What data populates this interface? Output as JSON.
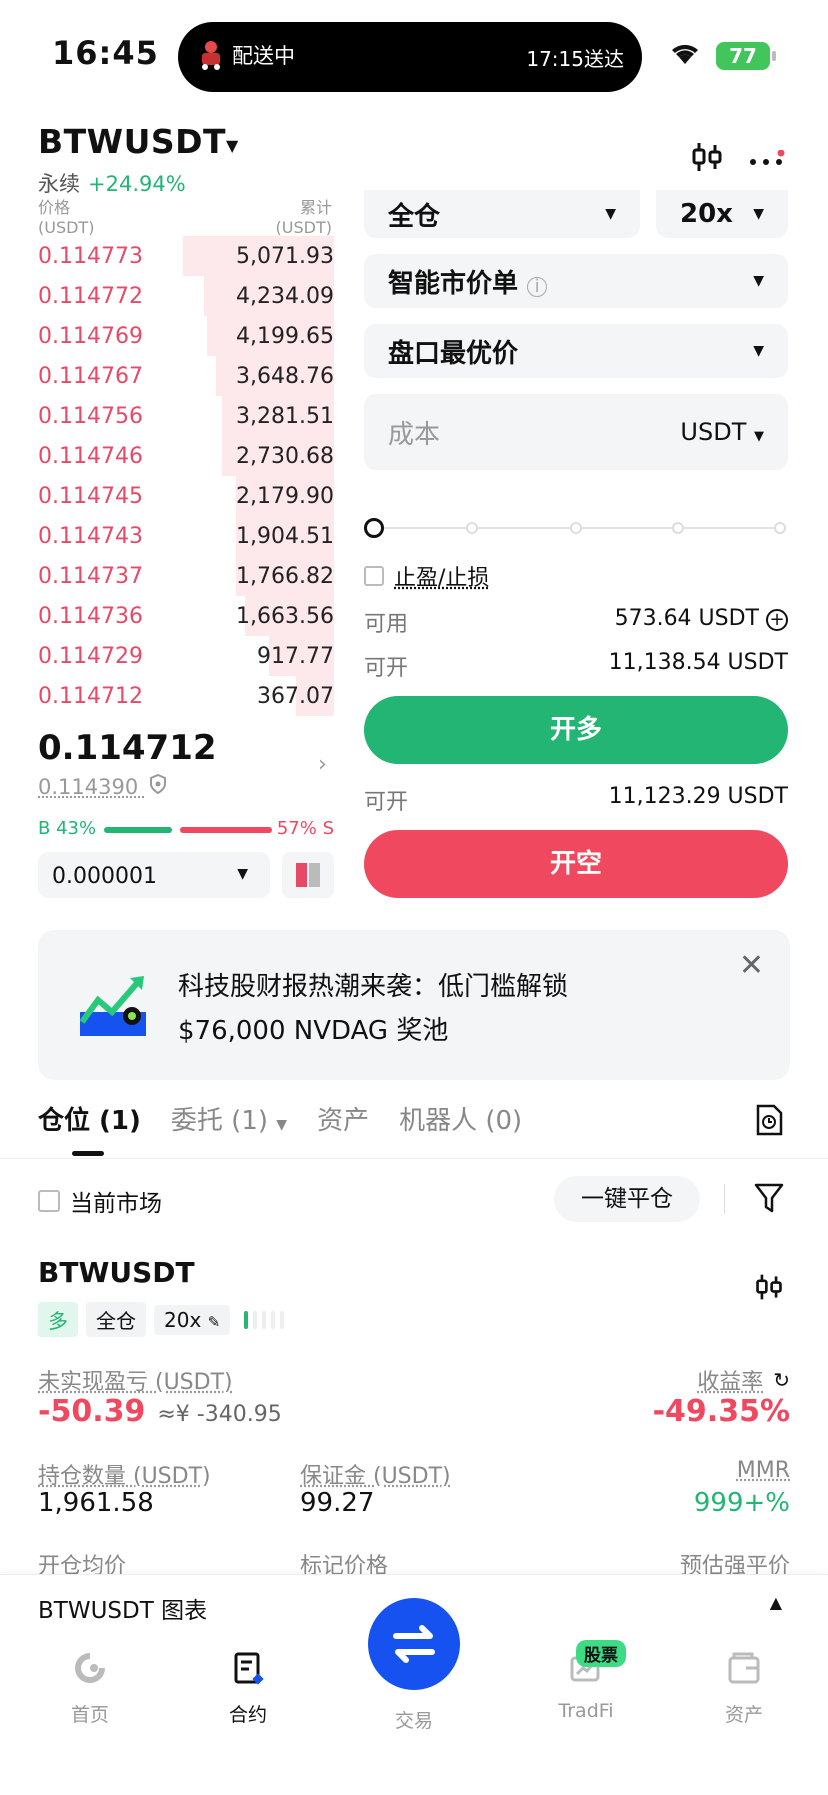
{
  "status_bar": {
    "time": "16:45",
    "island_left": "配送中",
    "island_right": "17:15送达",
    "battery": "77"
  },
  "header": {
    "symbol": "BTWUSDT",
    "type": "永续",
    "change": "+24.94%"
  },
  "orderbook": {
    "col_price": "价格",
    "col_price_unit": "(USDT)",
    "col_total": "累计",
    "col_total_unit": "(USDT)",
    "asks": [
      {
        "price": "0.114773",
        "qty": "5,071.93",
        "depth": 0.51
      },
      {
        "price": "0.114772",
        "qty": "4,234.09",
        "depth": 0.44
      },
      {
        "price": "0.114769",
        "qty": "4,199.65",
        "depth": 0.43
      },
      {
        "price": "0.114767",
        "qty": "3,648.76",
        "depth": 0.4
      },
      {
        "price": "0.114756",
        "qty": "3,281.51",
        "depth": 0.38
      },
      {
        "price": "0.114746",
        "qty": "2,730.68",
        "depth": 0.38
      },
      {
        "price": "0.114745",
        "qty": "2,179.90",
        "depth": 0.33
      },
      {
        "price": "0.114743",
        "qty": "1,904.51",
        "depth": 0.33
      },
      {
        "price": "0.114737",
        "qty": "1,766.82",
        "depth": 0.33
      },
      {
        "price": "0.114736",
        "qty": "1,663.56",
        "depth": 0.3
      },
      {
        "price": "0.114729",
        "qty": "917.77",
        "depth": 0.22
      },
      {
        "price": "0.114712",
        "qty": "367.07",
        "depth": 0.13
      }
    ],
    "last_price": "0.114712",
    "mark_price": "0.114390",
    "buy_ratio": "B 43%",
    "sell_ratio": "57% S",
    "buy_fraction": 0.43,
    "precision": "0.000001"
  },
  "form": {
    "margin_mode": "全仓",
    "leverage": "20x",
    "order_type": "智能市价单",
    "price_type": "盘口最优价",
    "amount_placeholder": "成本",
    "amount_unit": "USDT",
    "tpsl_label": "止盈/止损",
    "available_label": "可用",
    "available_value": "573.64 USDT",
    "open_long_label": "可开",
    "open_long_value": "11,138.54 USDT",
    "long_button": "开多",
    "open_short_label": "可开",
    "open_short_value": "11,123.29 USDT",
    "short_button": "开空"
  },
  "banner": {
    "line1": "科技股财报热潮来袭：低门槛解锁",
    "line2": "$76,000 NVDAG 奖池"
  },
  "tabs": [
    {
      "label": "仓位 (1)"
    },
    {
      "label": "委托 (1)"
    },
    {
      "label": "资产"
    },
    {
      "label": "机器人 (0)"
    }
  ],
  "filters": {
    "current_market": "当前市场",
    "close_all": "一键平仓"
  },
  "position": {
    "symbol": "BTWUSDT",
    "side": "多",
    "mode": "全仓",
    "leverage": "20x",
    "upnl_label": "未实现盈亏 (USDT)",
    "upnl_value": "-50.39",
    "upnl_cny": "≈¥ -340.95",
    "roe_label": "收益率",
    "roe_value": "-49.35%",
    "size_label": "持仓数量 (USDT)",
    "size_value": "1,961.58",
    "margin_label": "保证金 (USDT)",
    "margin_value": "99.27",
    "mmr_label": "MMR",
    "mmr_value": "999+%",
    "entry_label": "开仓均价",
    "markp_label": "标记价格",
    "liq_label": "预估强平价"
  },
  "chart_bar": {
    "label": "BTWUSDT 图表"
  },
  "nav": {
    "home": "首页",
    "contract": "合约",
    "trade": "交易",
    "tradfi": "TradFi",
    "tradfi_badge": "股票",
    "assets": "资产"
  },
  "colors": {
    "green": "#22b574",
    "red": "#f0485f",
    "blue": "#1652f0"
  }
}
